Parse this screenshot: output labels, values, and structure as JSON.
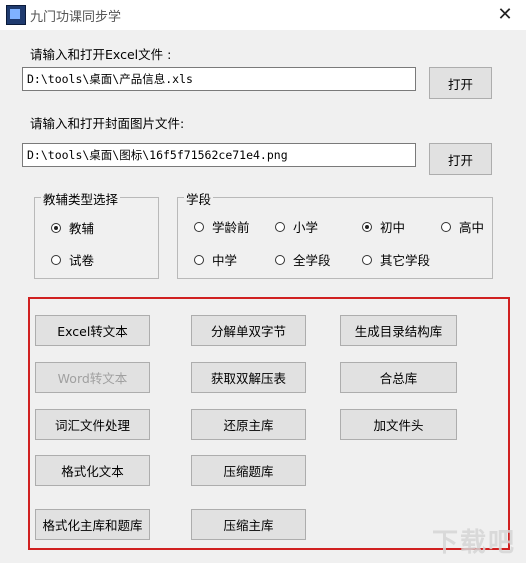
{
  "window": {
    "title": "九门功课同步学",
    "close_symbol": "✕"
  },
  "excel": {
    "label": "请输入和打开Excel文件 :",
    "value": "D:\\tools\\桌面\\产品信息.xls",
    "open_button": "打开"
  },
  "cover": {
    "label": "请输入和打开封面图片文件:",
    "value": "D:\\tools\\桌面\\图标\\16f5f71562ce71e4.png",
    "open_button": "打开"
  },
  "type_group": {
    "title": "教辅类型选择",
    "options": [
      {
        "label": "教辅",
        "checked": true
      },
      {
        "label": "试卷",
        "checked": false
      }
    ]
  },
  "stage_group": {
    "title": "学段",
    "options": [
      {
        "label": "学龄前",
        "checked": false
      },
      {
        "label": "小学",
        "checked": false
      },
      {
        "label": "初中",
        "checked": true
      },
      {
        "label": "高中",
        "checked": false
      },
      {
        "label": "中学",
        "checked": false
      },
      {
        "label": "全学段",
        "checked": false
      },
      {
        "label": "其它学段",
        "checked": false
      }
    ]
  },
  "actions": {
    "excel_to_text": "Excel转文本",
    "split_words": "分解单双字节",
    "gen_catalog": "生成目录结构库",
    "word_to_text": "Word转文本",
    "get_decompress": "获取双解压表",
    "merge_db": "合总库",
    "vocab_process": "词汇文件处理",
    "restore_main": "还原主库",
    "add_header": "加文件头",
    "format_text": "格式化文本",
    "compress_questions": "压缩题库",
    "format_main_questions": "格式化主库和题库",
    "compress_main": "压缩主库"
  },
  "watermark": "下载吧"
}
